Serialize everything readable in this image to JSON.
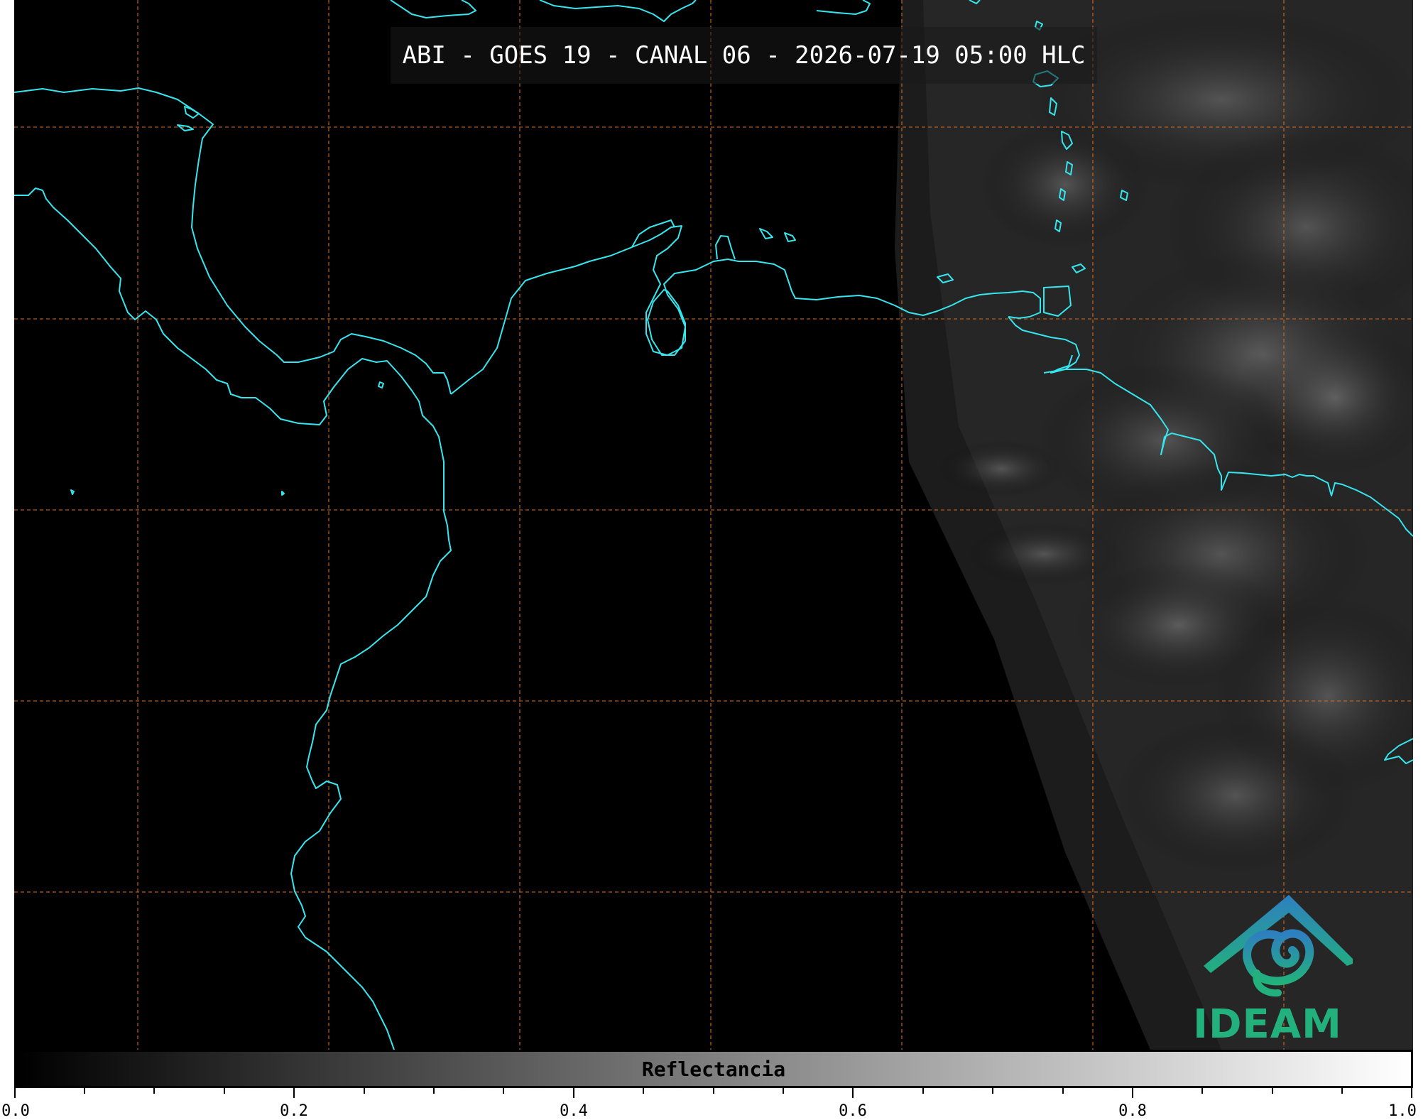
{
  "title": "ABI - GOES 19 - CANAL 06 - 2026-07-19 05:00 HLC",
  "logo": {
    "name": "IDEAM",
    "icon": "ideam-logo"
  },
  "colors": {
    "coastline": "#36e6ee",
    "gridline": "#d2691e",
    "logo_green": "#22b07d",
    "logo_blue": "#2e7fc0"
  },
  "colorbar": {
    "label": "Reflectancia",
    "range": [
      0.0,
      1.0
    ],
    "ticks": [
      "0.0",
      "0.2",
      "0.4",
      "0.6",
      "0.8",
      "1.0"
    ],
    "colormap": "grayscale"
  }
}
